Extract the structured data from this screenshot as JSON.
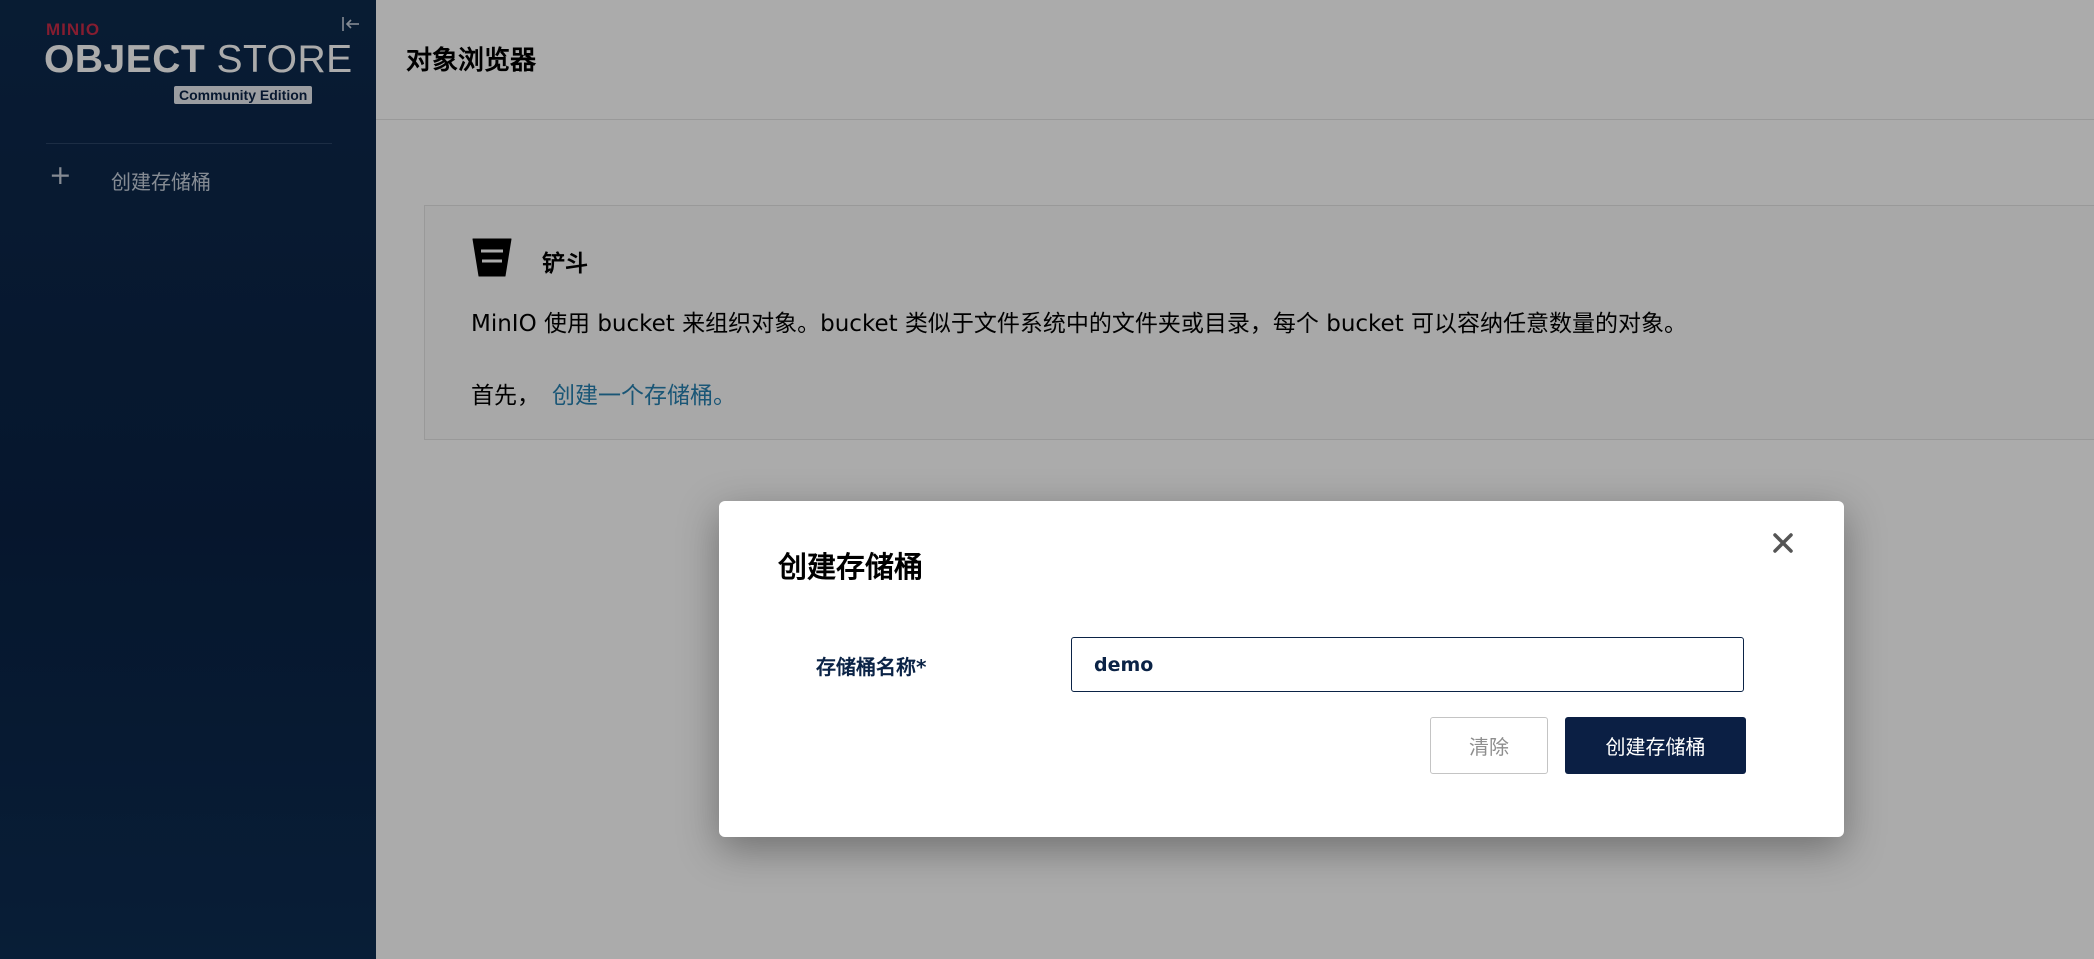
{
  "sidebar": {
    "brand_mark": "MINIO",
    "brand_title_bold": "OBJECT",
    "brand_title_light": " STORE",
    "edition": "Community Edition",
    "collapse_icon": "collapse-left-icon",
    "items": [
      {
        "icon": "plus-icon",
        "label": "创建存储桶"
      }
    ]
  },
  "header": {
    "title": "对象浏览器"
  },
  "info_card": {
    "icon": "bucket-icon",
    "title": "铲斗",
    "description": "MinIO 使用 bucket 来组织对象。bucket 类似于文件系统中的文件夹或目录，每个 bucket 可以容纳任意数量的对象。",
    "start_prefix": "首先，",
    "start_link": "创建一个存储桶。"
  },
  "modal": {
    "title": "创建存储桶",
    "close_icon": "close-icon",
    "field_label": "存储桶名称*",
    "field_value": "demo",
    "clear_label": "清除",
    "create_label": "创建存储桶"
  },
  "colors": {
    "sidebar_bg": "#0b2346",
    "accent": "#0b1f44",
    "link": "#2781b0",
    "brand_red": "#c72c48"
  }
}
